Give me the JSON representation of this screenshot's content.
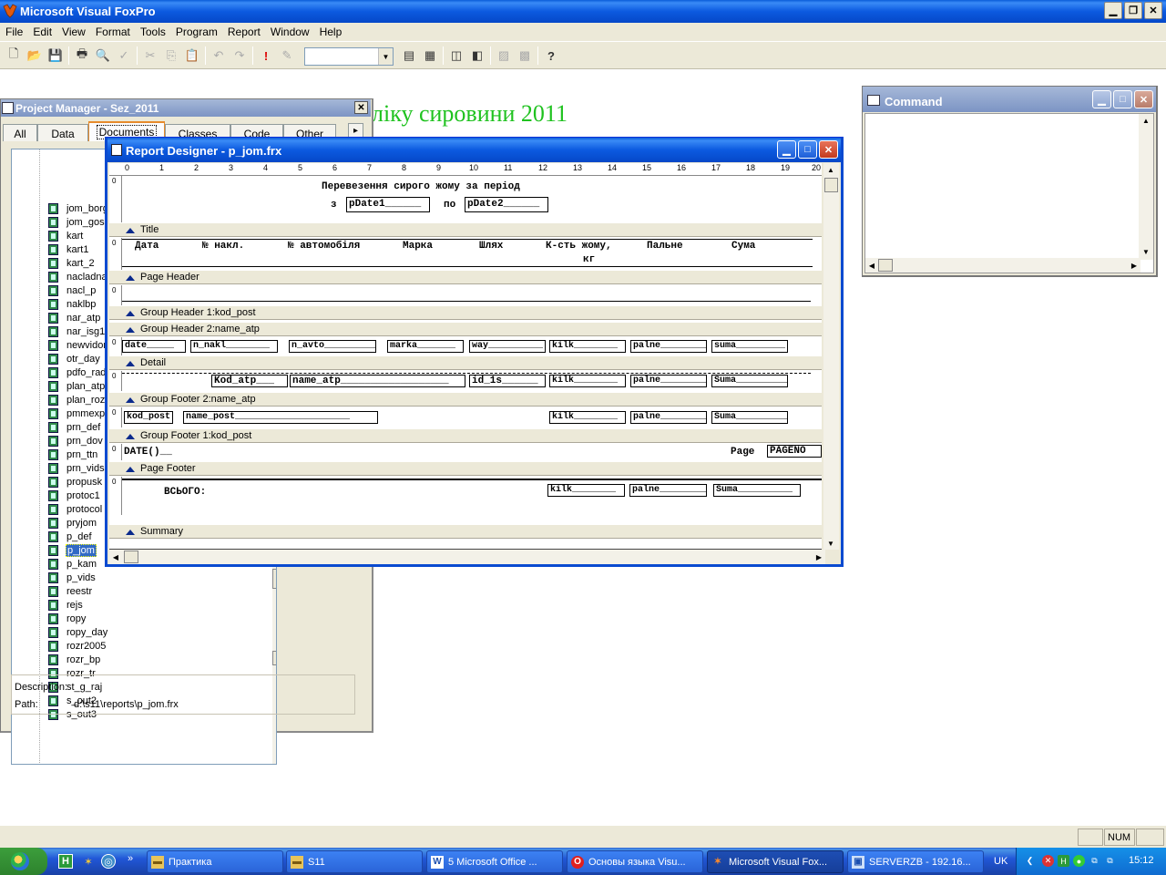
{
  "app": {
    "title": "Microsoft Visual FoxPro"
  },
  "menu": [
    "File",
    "Edit",
    "View",
    "Format",
    "Tools",
    "Program",
    "Report",
    "Window",
    "Help"
  ],
  "toolbar": {
    "icons": [
      "new-icon",
      "open-icon",
      "save-icon",
      "print-icon",
      "print-preview-icon",
      "spell-check-icon",
      "cut-icon",
      "copy-icon",
      "paste-icon",
      "undo-icon",
      "redo-icon",
      "run-icon",
      "modify-form-icon",
      "database-combo",
      "command-window-icon",
      "data-session-icon",
      "form-wizard-icon",
      "report-wizard-icon",
      "autoform-icon",
      "autoreport-icon",
      "help-icon"
    ],
    "combo_value": ""
  },
  "background_heading": "ліку сировини 2011",
  "project_manager": {
    "title": "Project Manager - Sez_2011",
    "tabs": [
      "All",
      "Data",
      "Documents",
      "Classes",
      "Code",
      "Other"
    ],
    "active_tab": "Documents",
    "items": [
      "jom_borg",
      "jom_gosp",
      "kart",
      "kart1",
      "kart_2",
      "nacladna",
      "nacl_p",
      "naklbp",
      "nar_atp",
      "nar_isg1",
      "newvidom",
      "otr_day",
      "pdfo_rad",
      "plan_atp",
      "plan_roz",
      "pmmexp",
      "prn_def",
      "prn_dov",
      "prn_ttn",
      "prn_vids",
      "propusk",
      "protoc1",
      "protocol",
      "pryjom",
      "p_def",
      "p_jom",
      "p_kam",
      "p_vids",
      "reestr",
      "rejs",
      "ropy",
      "ropy_day",
      "rozr2005",
      "rozr_bp",
      "rozr_tr",
      "st_g_raj",
      "s_out2",
      "s_out3"
    ],
    "selected": "p_jom",
    "description_label": "Description:",
    "description_value": "",
    "path_label": "Path:",
    "path_value": "d:\\s11\\reports\\p_jom.frx"
  },
  "report_designer": {
    "title": "Report Designer - p_jom.frx",
    "ruler_ticks": [
      "0",
      "1",
      "2",
      "3",
      "4",
      "5",
      "6",
      "7",
      "8",
      "9",
      "10",
      "11",
      "12",
      "13",
      "14",
      "15",
      "16",
      "17",
      "18",
      "19",
      "20"
    ],
    "title_band": {
      "line1": "Перевезення сирого жому за період",
      "from": "з",
      "field1": "pDate1______",
      "to": "по",
      "field2": "pDate2______"
    },
    "page_header": {
      "cols": [
        "Дата",
        "№ накл.",
        "№ автомобіля",
        "Марка",
        "Шлях",
        "К-сть жому,",
        "Пальне",
        "Сума"
      ],
      "unit": "кг"
    },
    "bands": {
      "title": "Title",
      "page_header": "Page Header",
      "group_header_1": "Group Header 1:kod_post",
      "group_header_2": "Group Header 2:name_atp",
      "detail": "Detail",
      "group_footer_2": "Group Footer 2:name_atp",
      "group_footer_1": "Group Footer 1:kod_post",
      "page_footer": "Page Footer",
      "summary": "Summary"
    },
    "detail_fields": [
      "date_____",
      "n_nakl________",
      "n_avto__________",
      "marka_______",
      "way__________",
      "kilk________",
      "palne_________",
      "suma_________"
    ],
    "gf2_fields": [
      "Kod_atp___",
      "name_atp__________________",
      "id_1s______",
      "kilk________",
      "palne_________",
      "Suma__________"
    ],
    "gf1_fields": [
      "kod_post",
      "name_post_____________________",
      "kilk________",
      "palne_________",
      "Suma__________"
    ],
    "page_footer": {
      "date": "DATE()__",
      "page_label": "Page",
      "page_field": "PAGENO"
    },
    "summary": {
      "label": "ВСЬОГО:",
      "fields": [
        "kilk________",
        "palne_________",
        "Suma__________"
      ]
    },
    "vruler_label": "0"
  },
  "command_window": {
    "title": "Command",
    "content": ""
  },
  "statusbar": {
    "num": "NUM"
  },
  "taskbar": {
    "tasks": [
      "Практика",
      "S11",
      "5 Microsoft Office ...",
      "Основы языка Visu...",
      "Microsoft Visual Fox...",
      "SERVERZB - 192.16..."
    ],
    "active": "Microsoft Visual Fox...",
    "language": "UK",
    "clock": "15:12"
  }
}
